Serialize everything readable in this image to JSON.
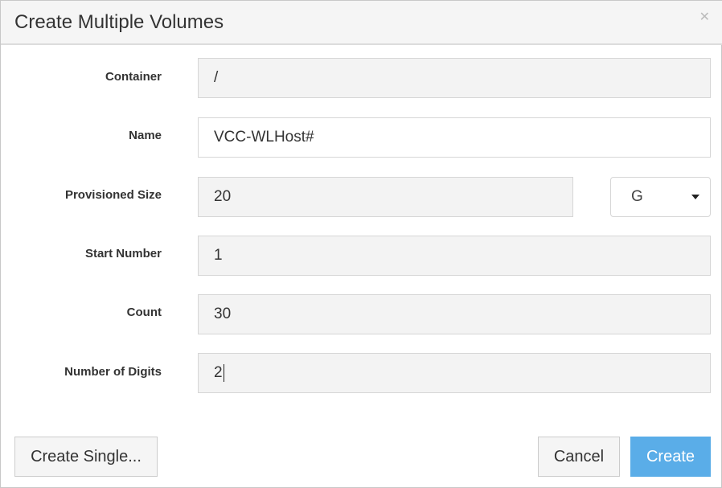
{
  "dialog": {
    "title": "Create Multiple Volumes",
    "close_icon": "close-icon"
  },
  "fields": {
    "container": {
      "label": "Container",
      "value": "/"
    },
    "name": {
      "label": "Name",
      "value": "VCC-WLHost#"
    },
    "size": {
      "label": "Provisioned Size",
      "value": "20",
      "unit": "G"
    },
    "start": {
      "label": "Start Number",
      "value": "1"
    },
    "count": {
      "label": "Count",
      "value": "30"
    },
    "digits": {
      "label": "Number of Digits",
      "value": "2"
    }
  },
  "buttons": {
    "single": "Create Single...",
    "cancel": "Cancel",
    "create": "Create"
  },
  "colors": {
    "primary": "#5aade8"
  }
}
